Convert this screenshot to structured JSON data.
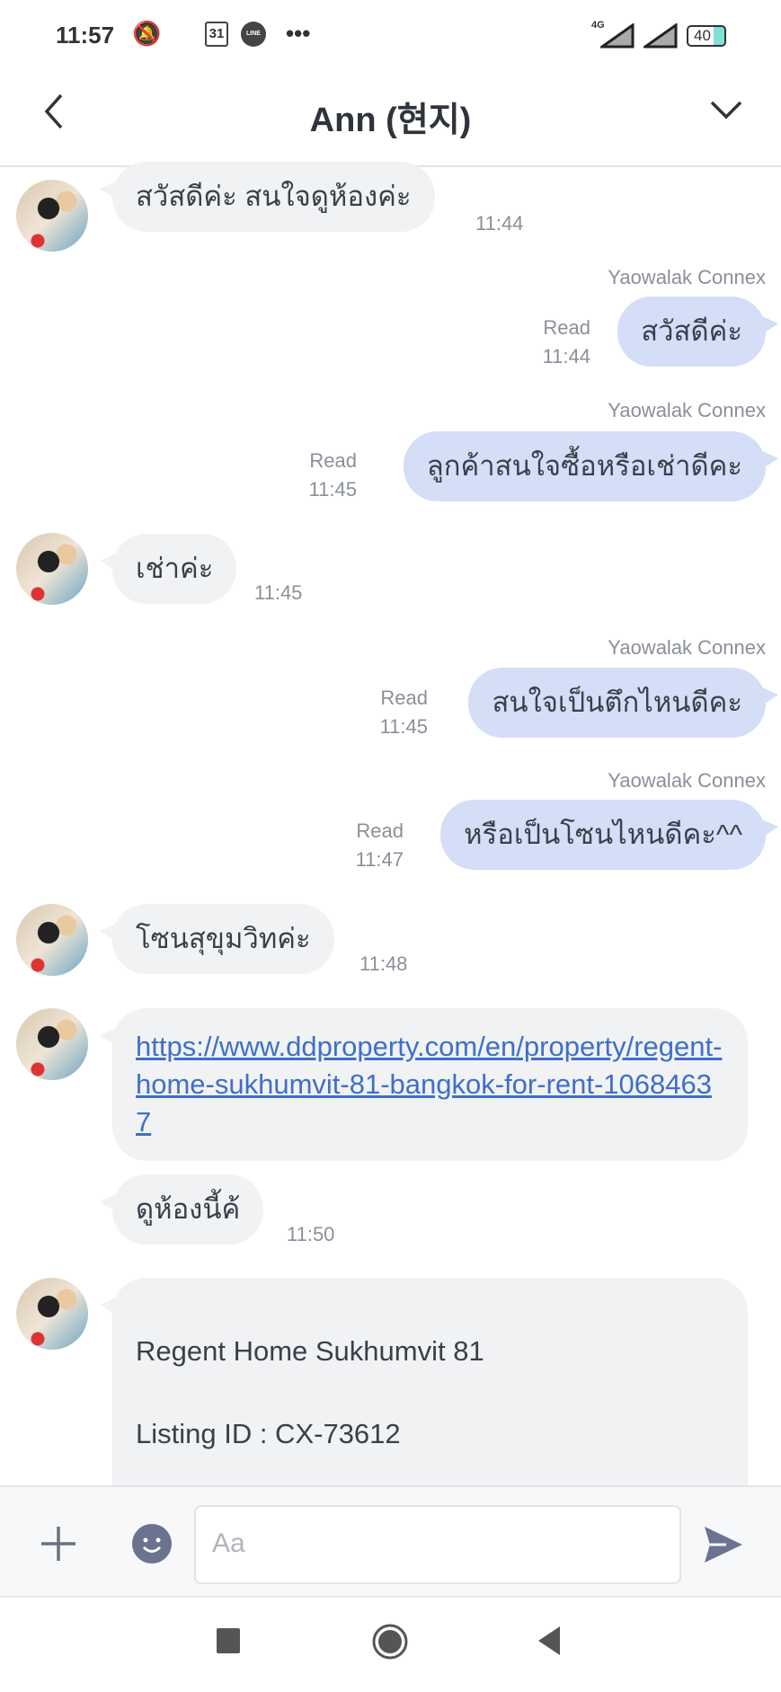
{
  "status_bar": {
    "time": "11:57",
    "calendar": "31",
    "app_badge": "LINE",
    "more": "•••",
    "network": "4G",
    "battery": "40"
  },
  "header": {
    "title": "Ann (현지)"
  },
  "messages": [
    {
      "dir": "in",
      "text": "สวัสดีค่ะ สนใจดูห้องค่ะ",
      "time": "11:44"
    },
    {
      "dir": "out",
      "sender": "Yaowalak Connex",
      "text": "สวัสดีค่ะ",
      "read": "Read",
      "time": "11:44"
    },
    {
      "dir": "out",
      "sender": "Yaowalak Connex",
      "text": "ลูกค้าสนใจซื้อหรือเช่าดีคะ",
      "read": "Read",
      "time": "11:45"
    },
    {
      "dir": "in",
      "text": "เช่าค่ะ",
      "time": "11:45"
    },
    {
      "dir": "out",
      "sender": "Yaowalak Connex",
      "text": "สนใจเป็นตึกไหนดีคะ",
      "read": "Read",
      "time": "11:45"
    },
    {
      "dir": "out",
      "sender": "Yaowalak Connex",
      "text": "หรือเป็นโซนไหนดีคะ^^",
      "read": "Read",
      "time": "11:47"
    },
    {
      "dir": "in",
      "text": "โซนสุขุมวิทค่ะ",
      "time": "11:48"
    },
    {
      "dir": "in",
      "link": "https://www.ddproperty.com/en/property/regent-home-sukhumvit-81-bangkok-for-rent-10684637"
    },
    {
      "dir": "in",
      "text": "ดูห้องนี้ค้",
      "time": "11:50"
    },
    {
      "dir": "in",
      "card_title": "Regent Home Sukhumvit 81",
      "card_listing": "Listing ID : CX-73612"
    }
  ],
  "input": {
    "placeholder": "Aa"
  }
}
